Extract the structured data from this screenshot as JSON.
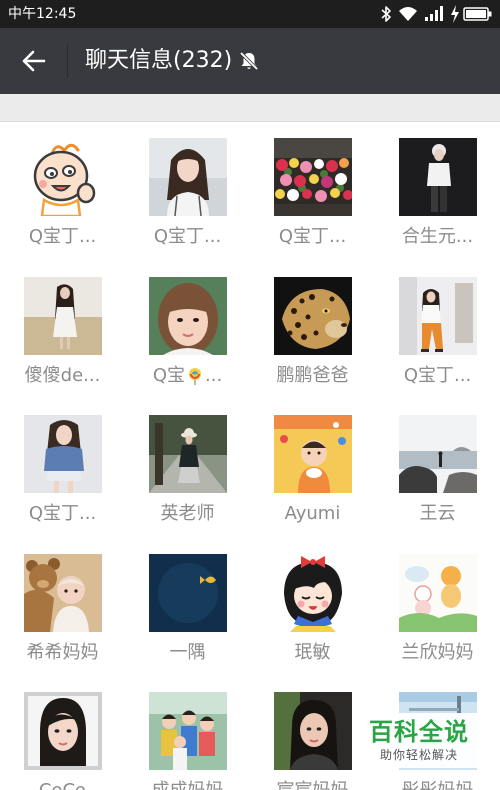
{
  "status_bar": {
    "time": "中午12:45",
    "icons": [
      "bluetooth-icon",
      "wifi-icon",
      "signal-icon",
      "charging-icon",
      "battery-icon"
    ]
  },
  "title_bar": {
    "back_icon": "back-arrow-icon",
    "title": "聊天信息(232)",
    "mute_icon": "mute-bell-icon"
  },
  "members": [
    {
      "name": "Q宝丁..."
    },
    {
      "name": "Q宝丁..."
    },
    {
      "name": "Q宝丁..."
    },
    {
      "name": "合生元..."
    },
    {
      "name": "傻傻de..."
    },
    {
      "name": "Q宝",
      "emoji": "lollipop-icon",
      "suffix": "..."
    },
    {
      "name": "鹏鹏爸爸"
    },
    {
      "name": "Q宝丁..."
    },
    {
      "name": "Q宝丁..."
    },
    {
      "name": "英老师"
    },
    {
      "name": "Ayumi"
    },
    {
      "name": "王云"
    },
    {
      "name": "希希妈妈"
    },
    {
      "name": "一隅"
    },
    {
      "name": "珉敏"
    },
    {
      "name": "兰欣妈妈"
    },
    {
      "name": "CoCo"
    },
    {
      "name": "成成妈妈"
    },
    {
      "name": "宸宸妈妈"
    },
    {
      "name": "彤彤妈妈"
    }
  ],
  "watermark": {
    "logo_text": "百科全说",
    "tagline": "助你轻松解决"
  },
  "colors": {
    "status_bar_bg": "#1e1e1e",
    "title_bar_bg": "#393a3f",
    "section_gap_bg": "#ebebeb",
    "member_name": "#8c8c8c",
    "watermark_green": "#2aa445"
  }
}
